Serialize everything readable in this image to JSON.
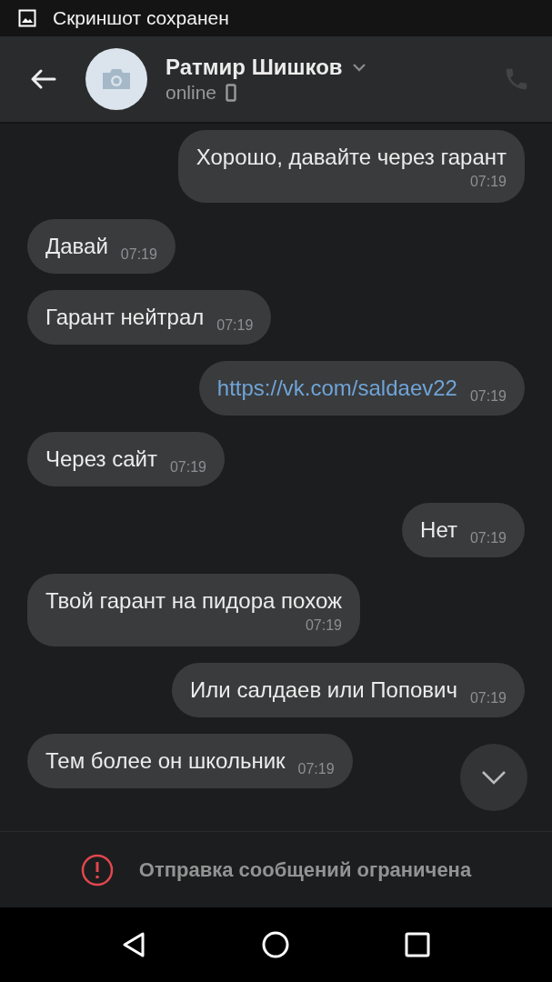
{
  "status_bar": {
    "notification": "Скриншот сохранен"
  },
  "header": {
    "name": "Ратмир Шишков",
    "status": "online"
  },
  "messages": [
    {
      "kind": "out",
      "text": "Хорошо, давайте через гарант",
      "time": "07:19",
      "time_below": true,
      "link": false
    },
    {
      "kind": "in",
      "text": "Давай",
      "time": "07:19",
      "time_below": false,
      "link": false
    },
    {
      "kind": "in",
      "text": "Гарант нейтрал",
      "time": "07:19",
      "time_below": false,
      "link": false
    },
    {
      "kind": "out",
      "text": "https://vk.com/saldaev22",
      "time": "07:19",
      "time_below": false,
      "link": true
    },
    {
      "kind": "in",
      "text": "Через сайт",
      "time": "07:19",
      "time_below": false,
      "link": false
    },
    {
      "kind": "out",
      "text": "Нет",
      "time": "07:19",
      "time_below": false,
      "link": false
    },
    {
      "kind": "in",
      "text": "Твой гарант на пидора похож",
      "time": "07:19",
      "time_below": true,
      "link": false
    },
    {
      "kind": "out",
      "text": "Или салдаев или Попович",
      "time": "07:19",
      "time_below": false,
      "link": false
    },
    {
      "kind": "in",
      "text": "Тем более он школьник",
      "time": "07:19",
      "time_below": false,
      "link": false
    }
  ],
  "footer": {
    "notice": "Отправка сообщений ограничена"
  }
}
